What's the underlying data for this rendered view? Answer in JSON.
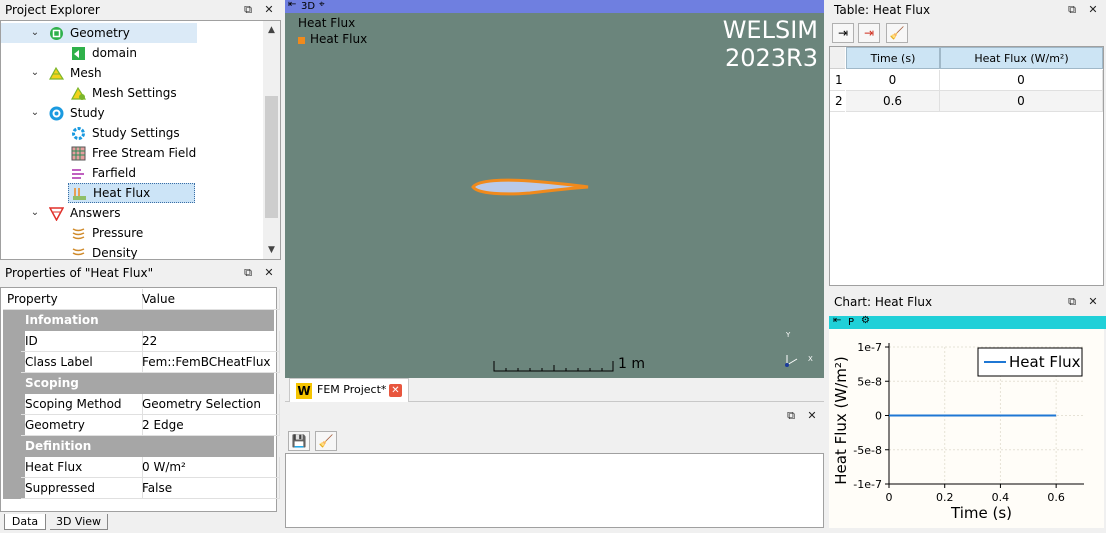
{
  "project_explorer": {
    "title": "Project Explorer",
    "items": [
      {
        "label": "Geometry"
      },
      {
        "label": "domain"
      },
      {
        "label": "Mesh"
      },
      {
        "label": "Mesh Settings"
      },
      {
        "label": "Study"
      },
      {
        "label": "Study Settings"
      },
      {
        "label": "Free Stream Field"
      },
      {
        "label": "Farfield"
      },
      {
        "label": "Heat Flux"
      },
      {
        "label": "Answers"
      },
      {
        "label": "Pressure"
      },
      {
        "label": "Density"
      }
    ]
  },
  "properties": {
    "title": "Properties of \"Heat Flux\"",
    "header": {
      "property": "Property",
      "value": "Value"
    },
    "rows": [
      {
        "group": "Infomation"
      },
      {
        "name": "ID",
        "value": "22"
      },
      {
        "name": "Class Label",
        "value": "Fem::FemBCHeatFlux"
      },
      {
        "group": "Scoping"
      },
      {
        "name": "Scoping Method",
        "value": "Geometry Selection"
      },
      {
        "name": "Geometry",
        "value": "2 Edge"
      },
      {
        "group": "Definition"
      },
      {
        "name": "Heat Flux",
        "value": "0 W/m²"
      },
      {
        "name": "Suppressed",
        "value": "False"
      }
    ]
  },
  "bottom_tabs": {
    "data": "Data",
    "view3d": "3D View"
  },
  "viewport": {
    "toolbar_label": "3D",
    "heading": "Heat Flux",
    "legend": "Heat Flux",
    "brand_line1": "WELSIM",
    "brand_line2": "2023R3",
    "scale_label": "1 m",
    "shape_fill": "#b9c9e8",
    "shape_stroke": "#f08a1c"
  },
  "document_tab": {
    "label": "FEM Project*"
  },
  "table": {
    "title": "Table: Heat Flux",
    "columns": [
      "Time (s)",
      "Heat Flux (W/m²)"
    ],
    "rows": [
      {
        "index": "1",
        "time": "0",
        "flux": "0"
      },
      {
        "index": "2",
        "time": "0.6",
        "flux": "0"
      }
    ]
  },
  "chart_panel": {
    "title": "Chart: Heat Flux",
    "toolbar_p": "P"
  },
  "chart_data": {
    "type": "line",
    "xlabel": "Time (s)",
    "ylabel": "Heat Flux (W/m²)",
    "xlim": [
      0,
      0.7
    ],
    "ylim": [
      -1e-07,
      1e-07
    ],
    "x_ticks": [
      "0",
      "0.2",
      "0.4",
      "0.6"
    ],
    "x_tick_values": [
      0,
      0.2,
      0.4,
      0.6
    ],
    "y_ticks": [
      "1e-7",
      "5e-8",
      "0",
      "-5e-8",
      "-1e-7"
    ],
    "y_tick_values": [
      1e-07,
      5e-08,
      0,
      -5e-08,
      -1e-07
    ],
    "series": [
      {
        "name": "Heat Flux",
        "x": [
          0,
          0.6
        ],
        "y": [
          0,
          0
        ],
        "color": "#1f77d4"
      }
    ],
    "legend_position": "top-right",
    "grid": true
  }
}
